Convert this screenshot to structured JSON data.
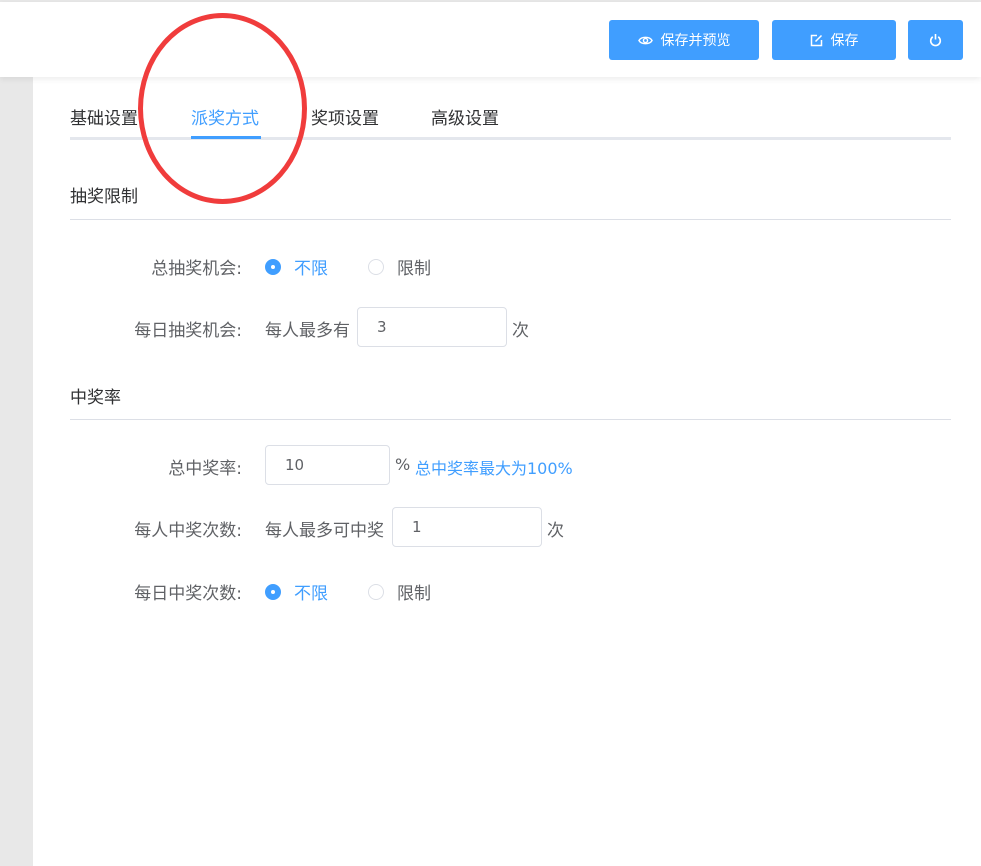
{
  "toolbar": {
    "preview_label": "保存并预览",
    "save_label": "保存"
  },
  "tabs": [
    {
      "label": "基础设置",
      "active": false
    },
    {
      "label": "派奖方式",
      "active": true
    },
    {
      "label": "奖项设置",
      "active": false
    },
    {
      "label": "高级设置",
      "active": false
    }
  ],
  "lottery_limit": {
    "title": "抽奖限制",
    "total_chance": {
      "label": "总抽奖机会:",
      "options": [
        "不限",
        "限制"
      ],
      "selected": "不限"
    },
    "daily_chance": {
      "label": "每日抽奖机会:",
      "prefix": "每人最多有",
      "value": "3",
      "suffix": "次"
    }
  },
  "win_rate": {
    "title": "中奖率",
    "total_rate": {
      "label": "总中奖率:",
      "value": "10",
      "unit": "%",
      "hint": "总中奖率最大为100%"
    },
    "per_person": {
      "label": "每人中奖次数:",
      "prefix": "每人最多可中奖",
      "value": "1",
      "suffix": "次"
    },
    "daily_wins": {
      "label": "每日中奖次数:",
      "options": [
        "不限",
        "限制"
      ],
      "selected": "不限"
    }
  },
  "colors": {
    "accent": "#409eff",
    "annotation": "#f03c3c"
  }
}
